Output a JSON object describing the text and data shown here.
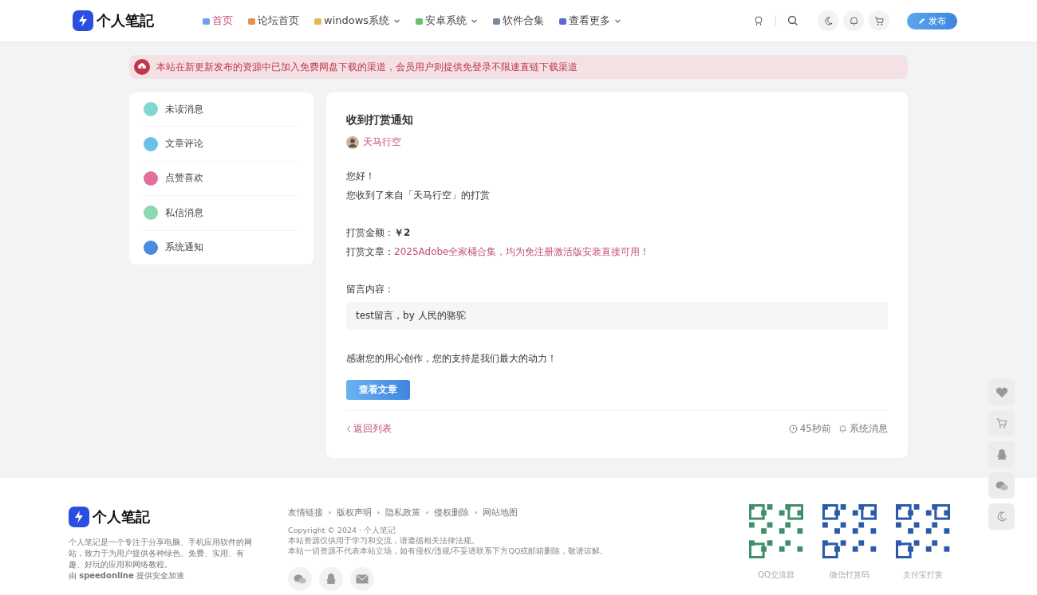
{
  "header": {
    "logo_text": "个人笔記",
    "nav": [
      {
        "label": "首页",
        "selected": true,
        "dropdown": false,
        "color": "#6fa0e8"
      },
      {
        "label": "论坛首页",
        "selected": false,
        "dropdown": false,
        "color": "#e8914f"
      },
      {
        "label": "windows系统",
        "selected": false,
        "dropdown": true,
        "color": "#e8b84f"
      },
      {
        "label": "安卓系统",
        "selected": false,
        "dropdown": true,
        "color": "#6cbf6a"
      },
      {
        "label": "软件合集",
        "selected": false,
        "dropdown": false,
        "color": "#7a8aa0"
      },
      {
        "label": "查看更多",
        "selected": false,
        "dropdown": true,
        "color": "#5a6ad0"
      }
    ],
    "publish_button": "发布"
  },
  "notice": "本站在新更新发布的资源中已加入免费网盘下载的渠道，会员用户则提供免登录不限速直链下载渠道",
  "sidebar": {
    "items": [
      {
        "label": "未读消息",
        "color": "#7fd8d0"
      },
      {
        "label": "文章评论",
        "color": "#6cc0e8"
      },
      {
        "label": "点赞喜欢",
        "color": "#e2709c"
      },
      {
        "label": "私信消息",
        "color": "#8ed8b0"
      },
      {
        "label": "系统通知",
        "color": "#4a8ae0"
      }
    ]
  },
  "message": {
    "title": "收到打赏通知",
    "author": "天马行空",
    "greeting": "您好！",
    "intro": "您收到了来自「天马行空」的打赏",
    "amount_label": "打赏金额：",
    "amount": "￥2",
    "article_label": "打赏文章：",
    "article": "2025Adobe全家桶合集，均为免注册激活版安装直接可用！",
    "comment_label": "留言内容：",
    "comment": "test留言，by 人民的骆驼",
    "thanks": "感谢您的用心创作，您的支持是我们最大的动力！",
    "view_button": "查看文章",
    "back_link": "返回列表",
    "time": "45秒前",
    "category": "系统消息"
  },
  "footer": {
    "logo_text": "个人笔記",
    "description": "个人笔记是一个专注于分享电脑、手机应用软件的网站，致力于为用户提供各种绿色、免费、实用、有趣、好玩的应用和网络教程。",
    "cdn_note": "由 **speedonline** 提供安全加速",
    "links": [
      "友情链接",
      "版权声明",
      "隐私政策",
      "侵权删除",
      "网站地图"
    ],
    "copyright": [
      "Copyright © 2024 · 个人笔记",
      "本站资源仅供用于学习和交流，请遵循相关法律法规。",
      "本站一切资源不代表本站立场，如有侵权/违规/不妥请联系下方QQ或邮箱删除，敬请谅解。"
    ],
    "qr_codes": [
      {
        "caption": "QQ交流群",
        "color": "#3f8f6a"
      },
      {
        "caption": "微信打赏码",
        "color": "#2a5aa8"
      },
      {
        "caption": "支付宝打赏",
        "color": "#2a5aa8"
      }
    ]
  }
}
